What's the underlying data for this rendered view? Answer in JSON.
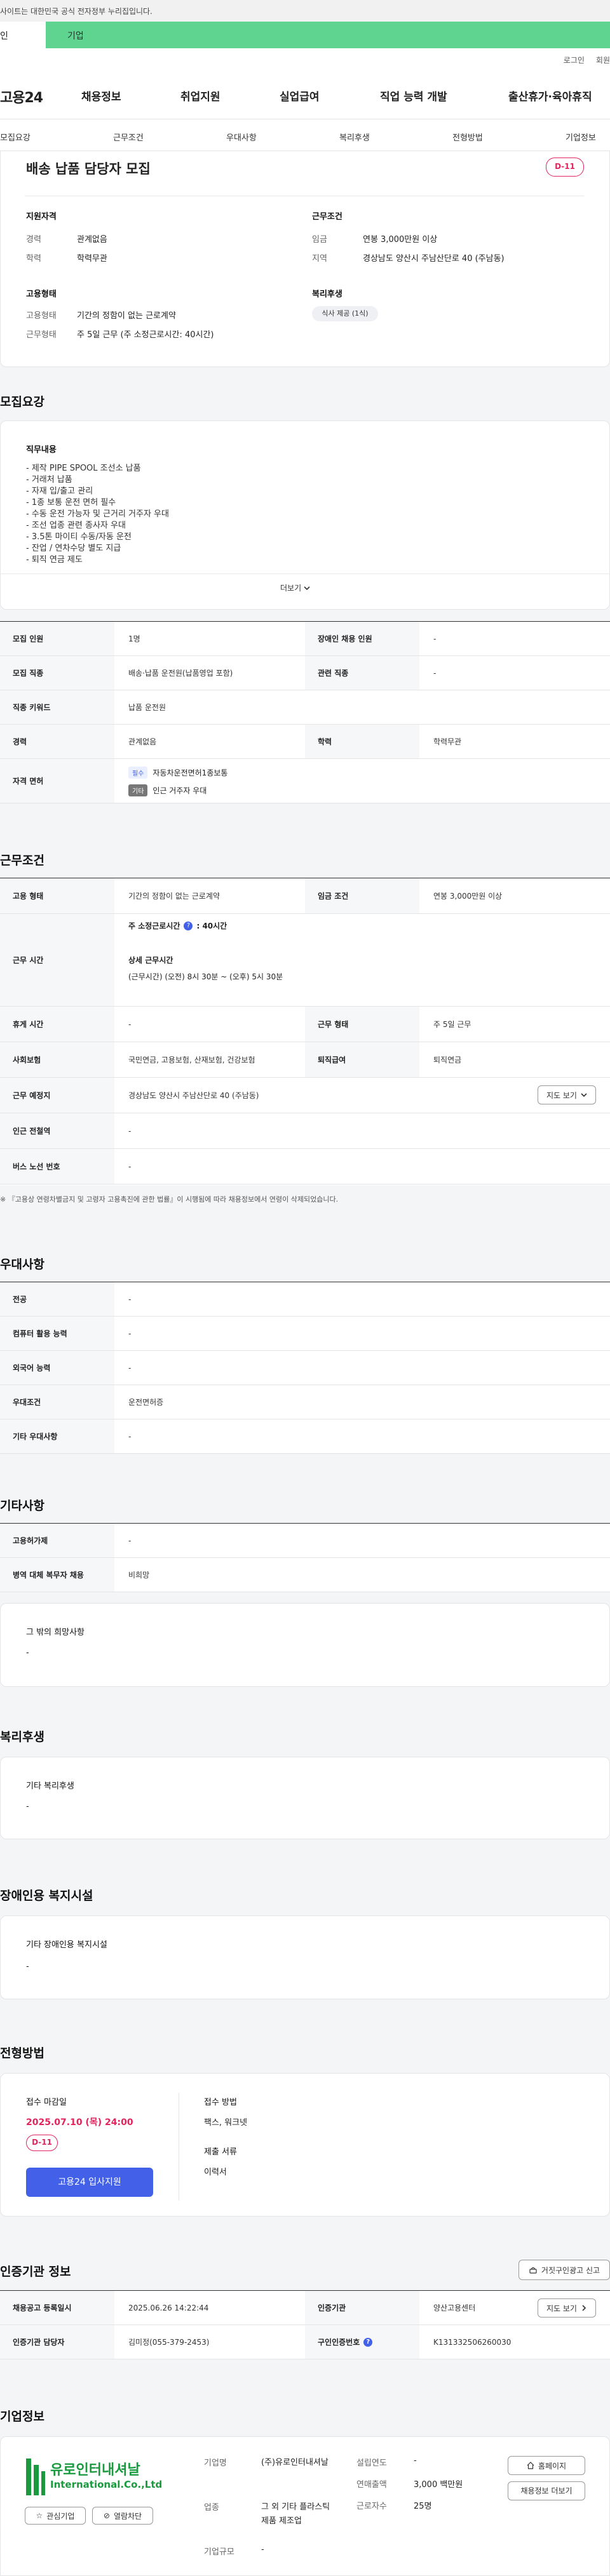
{
  "notice": {
    "text": "사이트는 대한민국 공식 전자정부 누리집입니다."
  },
  "tabs": {
    "personal": "인",
    "corporate": "기업"
  },
  "header": {
    "util": [
      "로그인",
      "회원"
    ],
    "logo": "고용24",
    "gnb": [
      "채용정보",
      "취업지원",
      "실업급여",
      "직업 능력 개발",
      "출산휴가·육아휴직"
    ]
  },
  "subnav": [
    "모집요강",
    "근무조건",
    "우대사항",
    "복리후생",
    "전형방법",
    "기업정보"
  ],
  "summary": {
    "title": "배송 납품 담당자 모집",
    "dday": "D-11",
    "qual_title": "지원자격",
    "qual": [
      {
        "k": "경력",
        "v": "관계없음"
      },
      {
        "k": "학력",
        "v": "학력무관"
      }
    ],
    "cond_title": "근무조건",
    "cond": [
      {
        "k": "임금",
        "v": "연봉 3,000만원 이상"
      },
      {
        "k": "지역",
        "v": "경상남도 양산시 주남산단로 40 (주남동)"
      }
    ],
    "emp_title": "고용형태",
    "emp": [
      {
        "k": "고용형태",
        "v": "기간의 정함이 없는 근로계약"
      },
      {
        "k": "근무형태",
        "v": "주 5일 근무 (주 소정근로시간: 40시간)"
      }
    ],
    "welfare_title": "복리후생",
    "welfare_chip": "식사 제공 (1식)"
  },
  "recruit": {
    "title": "모집요강",
    "duty_label": "직무내용",
    "duties": [
      "- 제작 PIPE SPOOL 조선소 납품",
      "- 거래처 납품",
      "- 자재 입/출고 관리",
      "- 1종 보통 운전 면허 필수",
      "- 수동 운전 가능자 및 근거리 거주자 우대",
      "- 조선 업종 관련 종사자 우대",
      "- 3.5톤 마이티 수동/자동 운전",
      "- 잔업 / 연차수당 별도 지급",
      "- 퇴직 연금 제도"
    ],
    "more": "더보기",
    "rows": [
      {
        "k": "모집 인원",
        "v": "1명",
        "k2": "장애인 채용 인원",
        "v2": "-"
      },
      {
        "k": "모집 직종",
        "v": "배송·납품 운전원(납품영업 포함)",
        "k2": "관련 직종",
        "v2": "-"
      },
      {
        "k": "직종 키워드",
        "v": "납품 운전원"
      },
      {
        "k": "경력",
        "v": "관계없음",
        "k2": "학력",
        "v2": "학력무관"
      }
    ],
    "license_label": "자격 면허",
    "license_tag1": "필수",
    "license_v1": "자동차운전면허1종보통",
    "license_tag2": "기타",
    "license_v2": "인근 거주자 우대"
  },
  "work": {
    "title": "근무조건",
    "emp_k": "고용 형태",
    "emp_v": "기간의 정함이 없는 근로계약",
    "wage_k": "임금 조건",
    "wage_v": "연봉 3,000만원 이상",
    "hours_k": "근무 시간",
    "hours_std_label": "주 소정근로시간",
    "hours_std_v": ": 40시간",
    "hours_detail_label": "상세 근무시간",
    "hours_detail_v": "(근무시간) (오전) 8시 30분 ~ (오후) 5시 30분",
    "rest_k": "휴게 시간",
    "rest_v": "-",
    "shift_k": "근무 형태",
    "shift_v": "주 5일 근무",
    "ins_k": "사회보험",
    "ins_v": "국민연금, 고용보험, 산재보험, 건강보험",
    "ret_k": "퇴직급여",
    "ret_v": "퇴직연금",
    "loc_k": "근무 예정지",
    "loc_v": "경상남도 양산시 주남산단로 40 (주남동)",
    "map_btn": "지도 보기",
    "sub_k": "인근 전철역",
    "sub_v": "-",
    "bus_k": "버스 노선 번호",
    "bus_v": "-",
    "note": "※ 『고용상 연령차별금지 및 고령자 고용촉진에 관한 법률』이 시행됨에 따라 채용정보에서 연령이 삭제되었습니다."
  },
  "pref": {
    "title": "우대사항",
    "rows": [
      {
        "k": "전공",
        "v": "-"
      },
      {
        "k": "컴퓨터 활용 능력",
        "v": "-"
      },
      {
        "k": "외국어 능력",
        "v": "-"
      },
      {
        "k": "우대조건",
        "v": "운전면허증"
      },
      {
        "k": "기타 우대사항",
        "v": "-"
      }
    ]
  },
  "other": {
    "title": "기타사항",
    "rows": [
      {
        "k": "고용허가제",
        "v": "-"
      },
      {
        "k": "병역 대체 복무자 채용",
        "v": "비희망"
      }
    ],
    "extra_label": "그 밖의 희망사항",
    "extra_v": "-"
  },
  "welfare": {
    "title": "복리후생",
    "label": "기타 복리후생",
    "v": "-"
  },
  "disabled": {
    "title": "장애인용 복지시설",
    "label": "기타 장애인용 복지시설",
    "v": "-"
  },
  "process": {
    "title": "전형방법",
    "deadline_label": "접수 마감일",
    "deadline_v": "2025.07.10 (목) 24:00",
    "dday": "D-11",
    "apply_btn": "고용24 입사지원",
    "method_label": "접수 방법",
    "method_v": "팩스, 워크넷",
    "docs_label": "제출 서류",
    "docs_v": "이력서"
  },
  "cert": {
    "title": "인증기관 정보",
    "report_btn": "거짓구인광고 신고",
    "reg_k": "채용공고 등록일시",
    "reg_v": "2025.06.26 14:22:44",
    "org_k": "인증기관",
    "org_v": "양산고용센터",
    "map_btn": "지도 보기",
    "mgr_k": "인증기관 담당자",
    "mgr_v": "김미정(055-379-2453)",
    "cid_k": "구인인증번호",
    "cid_v": "K131332506260030"
  },
  "company": {
    "title": "기업정보",
    "logo_text_line1": "유로인터내셔날",
    "logo_text_line2": "International.Co.,Ltd",
    "fav_btn": "관심기업",
    "block_btn": "열람차단",
    "name_k": "기업명",
    "name_v": "(주)유로인터내셔날",
    "ind_k": "업종",
    "ind_v": "그 외 기타 플라스틱 제품 제조업",
    "size_k": "기업규모",
    "size_v": "-",
    "est_k": "설립연도",
    "est_v": "-",
    "sales_k": "연매출액",
    "sales_v": "3,000 백만원",
    "emp_k": "근로자수",
    "emp_v": "25명",
    "home_btn": "홈페이지",
    "jobs_btn": "채용정보 더보기"
  },
  "colors": {
    "accent_green": "#5fd490",
    "primary_blue": "#4361e8",
    "dday_red": "#e0245e"
  }
}
